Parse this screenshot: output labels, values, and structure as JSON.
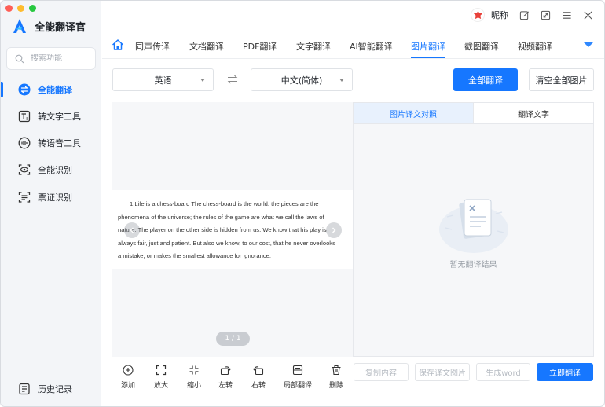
{
  "app": {
    "name": "全能翻译官"
  },
  "sidebar": {
    "search_placeholder": "搜索功能",
    "items": [
      {
        "label": "全能翻译",
        "icon": "translate-icon",
        "active": true
      },
      {
        "label": "转文字工具",
        "icon": "text-convert-icon",
        "active": false
      },
      {
        "label": "转语音工具",
        "icon": "voice-icon",
        "active": false
      },
      {
        "label": "全能识别",
        "icon": "recognize-icon",
        "active": false
      },
      {
        "label": "票证识别",
        "icon": "ticket-scan-icon",
        "active": false
      }
    ],
    "history_label": "历史记录"
  },
  "topbar": {
    "nickname": "昵称"
  },
  "tabs": [
    {
      "label": "同声传译"
    },
    {
      "label": "文档翻译"
    },
    {
      "label": "PDF翻译"
    },
    {
      "label": "文字翻译"
    },
    {
      "label": "AI智能翻译"
    },
    {
      "label": "图片翻译",
      "active": true
    },
    {
      "label": "截图翻译"
    },
    {
      "label": "视频翻译"
    }
  ],
  "lang": {
    "source": "英语",
    "target": "中文(简体)"
  },
  "actions": {
    "translate_all": "全部翻译",
    "clear_all": "清空全部图片"
  },
  "preview": {
    "lines": [
      "1.Life is a chess-board The chess-board is the world: the pieces are the",
      "phenomena of the universe; the rules of the game are what we call the laws of",
      "nature. The player on the other side is hidden from us. We know that his play is",
      "always fair, just and patient. But also we know, to our cost, that he never overlooks",
      "a mistake, or makes the smallest allowance for ignorance."
    ],
    "pager": "1 / 1"
  },
  "tools": [
    {
      "label": "添加",
      "icon": "add-icon"
    },
    {
      "label": "放大",
      "icon": "zoom-in-icon"
    },
    {
      "label": "缩小",
      "icon": "zoom-out-icon"
    },
    {
      "label": "左转",
      "icon": "rotate-left-icon"
    },
    {
      "label": "右转",
      "icon": "rotate-right-icon"
    },
    {
      "label": "局部翻译",
      "icon": "partial-translate-icon"
    },
    {
      "label": "删除",
      "icon": "trash-icon"
    }
  ],
  "result": {
    "tabs": [
      {
        "label": "图片译文对照",
        "active": true
      },
      {
        "label": "翻译文字"
      }
    ],
    "empty_text": "暂无翻译结果",
    "buttons": {
      "copy": "复制内容",
      "save_image": "保存译文图片",
      "gen_word": "生成word",
      "translate_now": "立即翻译"
    }
  },
  "colors": {
    "accent": "#1677ff",
    "sidebar_bg": "#f3f5f8"
  }
}
